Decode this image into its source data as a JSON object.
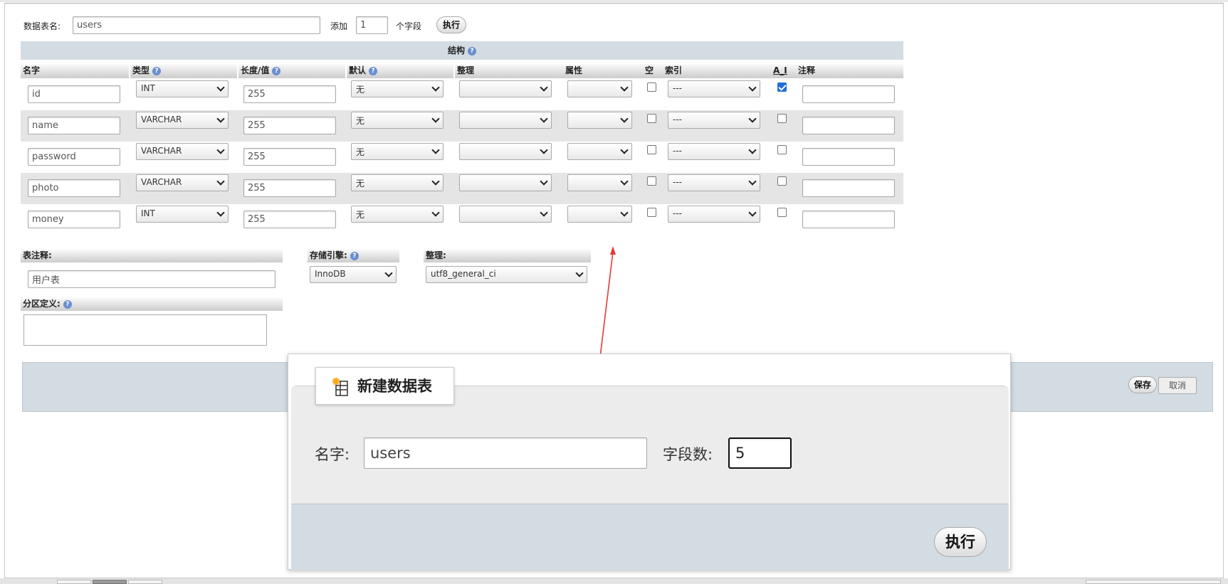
{
  "top": {
    "table_name_label": "数据表名:",
    "table_name_value": "users",
    "add_label": "添加",
    "add_count": "1",
    "fields_label": "个字段",
    "exec_label": "执行"
  },
  "structure": {
    "header": "结构",
    "columns": [
      "名字",
      "类型",
      "长度/值",
      "默认",
      "整理",
      "属性",
      "空",
      "索引",
      "A_I",
      "注释"
    ],
    "rows": [
      {
        "name": "id",
        "type": "INT",
        "length": "255",
        "default": "无",
        "collation": "",
        "attribute": "",
        "null": false,
        "index": "---",
        "ai": true,
        "comment": ""
      },
      {
        "name": "name",
        "type": "VARCHAR",
        "length": "255",
        "default": "无",
        "collation": "",
        "attribute": "",
        "null": false,
        "index": "---",
        "ai": false,
        "comment": ""
      },
      {
        "name": "password",
        "type": "VARCHAR",
        "length": "255",
        "default": "无",
        "collation": "",
        "attribute": "",
        "null": false,
        "index": "---",
        "ai": false,
        "comment": ""
      },
      {
        "name": "photo",
        "type": "VARCHAR",
        "length": "255",
        "default": "无",
        "collation": "",
        "attribute": "",
        "null": false,
        "index": "---",
        "ai": false,
        "comment": ""
      },
      {
        "name": "money",
        "type": "INT",
        "length": "255",
        "default": "无",
        "collation": "",
        "attribute": "",
        "null": false,
        "index": "---",
        "ai": false,
        "comment": ""
      }
    ]
  },
  "options": {
    "table_comment_label": "表注释:",
    "table_comment_value": "用户表",
    "engine_label": "存储引擎:",
    "engine_value": "InnoDB",
    "collation_label": "整理:",
    "collation_value": "utf8_general_ci",
    "partition_label": "分区定义:"
  },
  "footer": {
    "save_label": "保存",
    "cancel_label": "取消"
  },
  "dialog": {
    "title": "新建数据表",
    "name_label": "名字:",
    "name_value": "users",
    "field_count_label": "字段数:",
    "field_count_value": "5",
    "exec_label": "执行"
  },
  "colors": {
    "header_band": "#d3dce3",
    "alt_row": "#e5e5e5",
    "arrow": "#e53935",
    "checkbox_on": "#1e6fd9"
  }
}
